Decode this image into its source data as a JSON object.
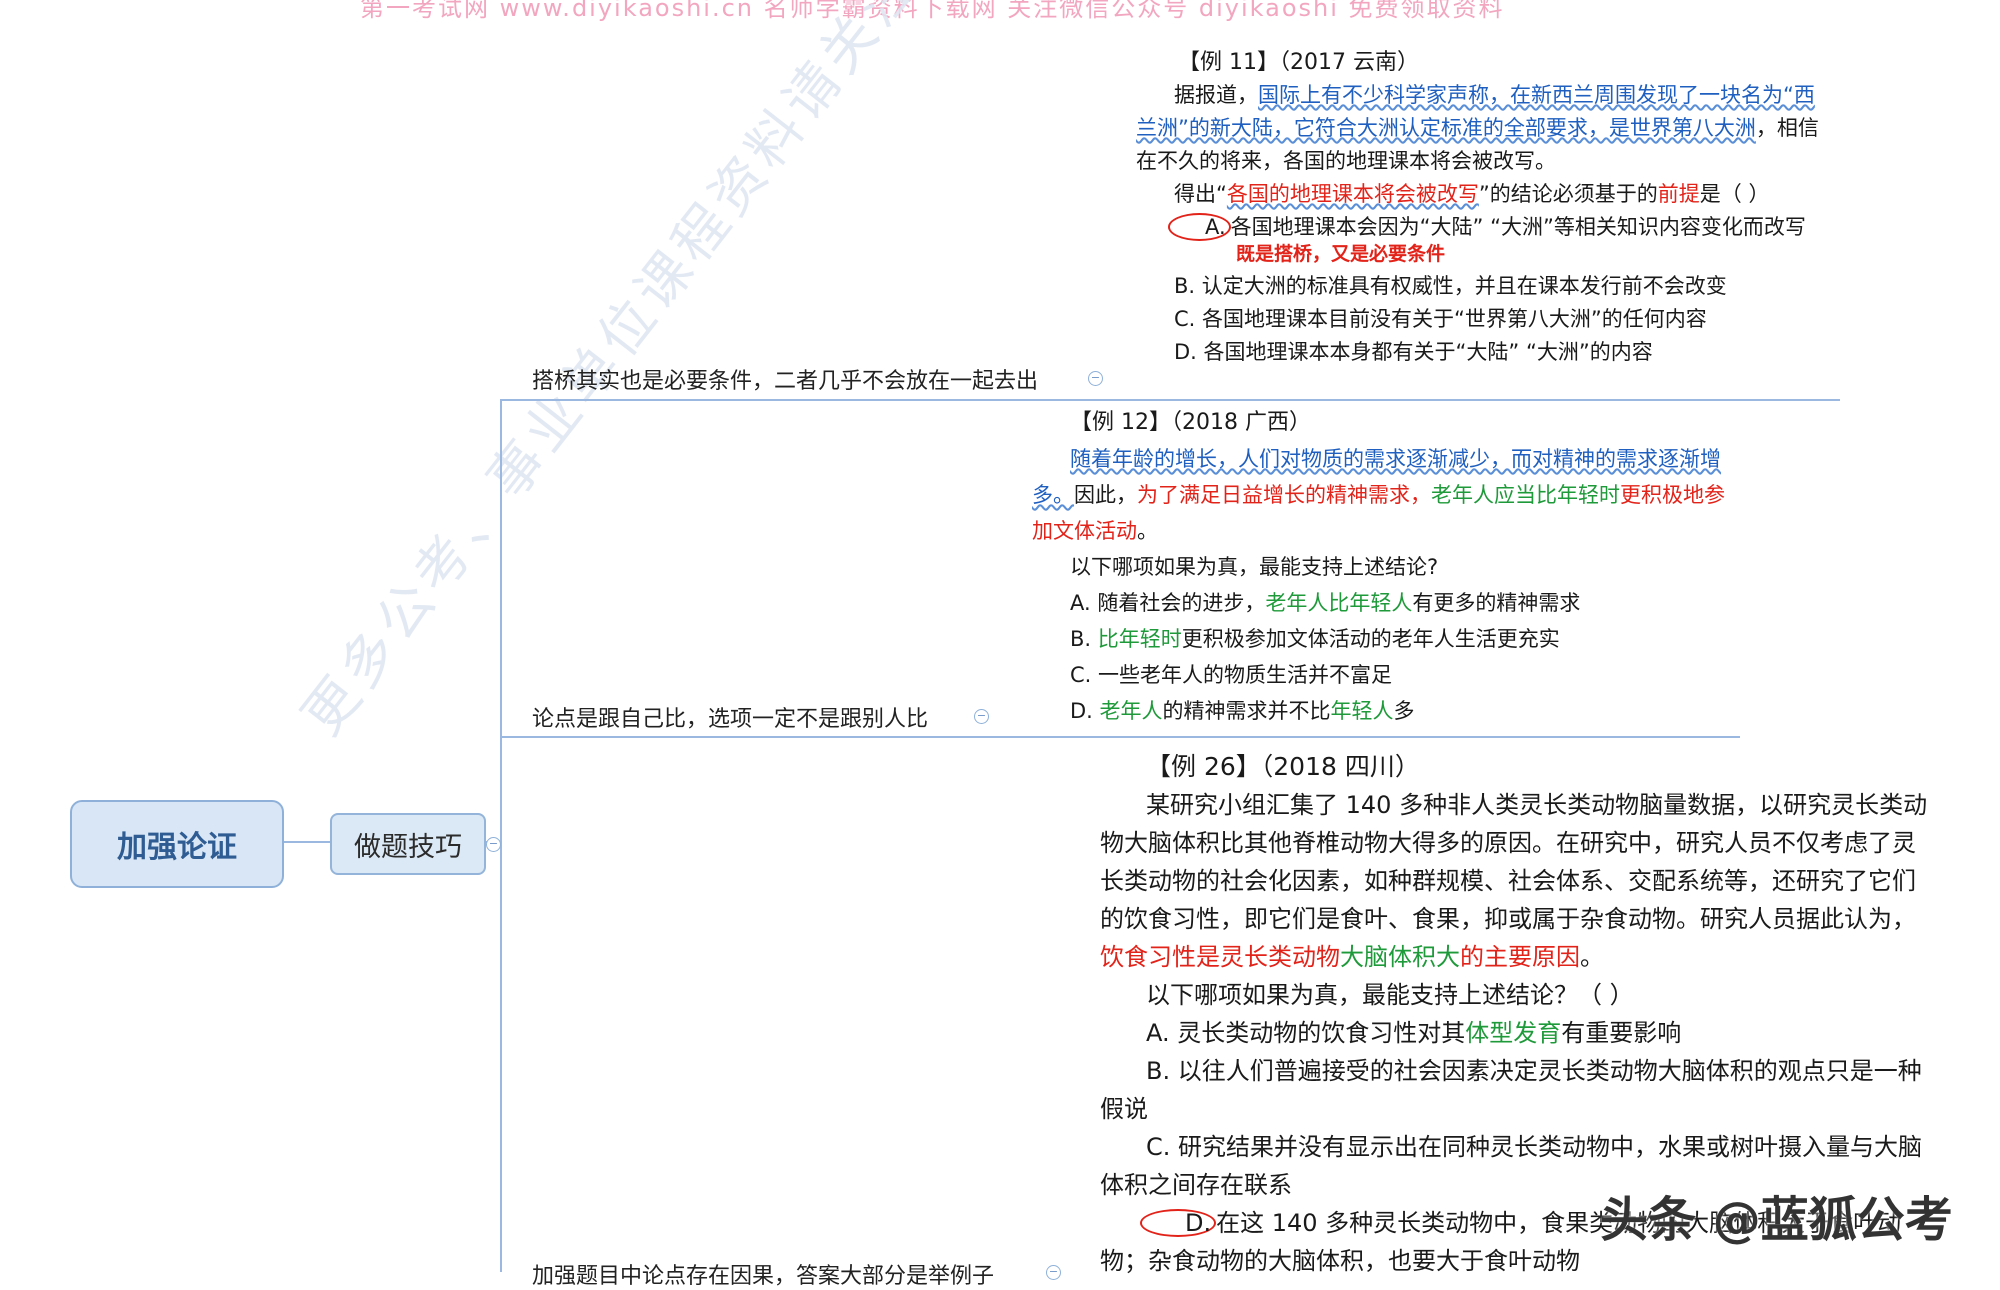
{
  "banner": "第一考试网 www.diyikaoshi.cn 名师学霸资料下载网 关注微信公众号 diyikaoshi 免费领取资料",
  "watermark": "更多公考、事业单位课程资料请关注",
  "brand": "头条 @蓝狐公考",
  "root": {
    "label": "加强论证"
  },
  "child": {
    "label": "做题技巧"
  },
  "branches": [
    {
      "label": "搭桥其实也是必要条件，二者几乎不会放在一起去出"
    },
    {
      "label": "论点是跟自己比，选项一定不是跟别人比"
    },
    {
      "label": "加强题目中论点存在因果，答案大部分是举例子"
    }
  ],
  "ex11": {
    "header": "【例 11】（2017 云南）",
    "p1_lead": "据报道，",
    "p1_blue": "国际上有不少科学家声称，在新西兰周围发现了一块名为“西兰洲”的新大陆，它符合大洲认定标准的全部要求，是世界第八大洲",
    "p1_tail": "，相信在不久的将来，各国的地理课本将会被改写。",
    "q_a": "得出“",
    "q_red": "各国的地理课本将会被改写",
    "q_b": "”的结论必须基于的",
    "q_red2": "前提",
    "q_c": "是（ ）",
    "optA_letter": "A.",
    "optA_text": "各国地理课本会因为“大陆” “大洲”等相关知识内容变化而改写",
    "note": "既是搭桥，又是必要条件",
    "optB": "B. 认定大洲的标准具有权威性，并且在课本发行前不会改变",
    "optC": "C. 各国地理课本目前没有关于“世界第八大洲”的任何内容",
    "optD": "D. 各国地理课本本身都有关于“大陆” “大洲”的内容"
  },
  "ex12": {
    "header": "【例 12】（2018 广西）",
    "blue": "随着年龄的增长，人们对物质的需求逐渐减少，而对精神的需求逐渐增多。",
    "mid": "因此，",
    "red1": "为了满足日益增长的精神需求，",
    "green1": "老年人应当比年轻时",
    "red2": "更积极地参加文体活动",
    "end": "。",
    "question": "以下哪项如果为真，最能支持上述结论?",
    "optA_a": "A. 随着社会的进步，",
    "optA_g": "老年人比年轻人",
    "optA_b": "有更多的精神需求",
    "optB_a": "B. ",
    "optB_g": "比年轻时",
    "optB_b": "更积极参加文体活动的老年人生活更充实",
    "optC": "C. 一些老年人的物质生活并不富足",
    "optD_a": "D. ",
    "optD_g": "老年人",
    "optD_b": "的精神需求并不比",
    "optD_g2": "年轻人",
    "optD_c": "多"
  },
  "ex26": {
    "header": "【例 26】（2018 四川）",
    "body": "某研究小组汇集了 140 多种非人类灵长类动物脑量数据，以研究灵长类动物大脑体积比其他脊椎动物大得多的原因。在研究中，研究人员不仅考虑了灵长类动物的社会化因素，如种群规模、社会体系、交配系统等，还研究了它们的饮食习性，即它们是食叶、食果，抑或属于杂食动物。研究人员据此认为，",
    "red1": "饮食习性是灵长类动物",
    "green1": "大脑体积大",
    "red2": "的主要原因",
    "end": "。",
    "question": "以下哪项如果为真，最能支持上述结论？（ ）",
    "optA_a": "A. 灵长类动物的饮食习性对其",
    "optA_g": "体型发育",
    "optA_b": "有重要影响",
    "optB": "B. 以往人们普遍接受的社会因素决定灵长类动物大脑体积的观点只是一种假说",
    "optC": "C. 研究结果并没有显示出在同种灵长类动物中，水果或树叶摄入量与大脑体积之间存在联系",
    "optD_letter": "D.",
    "optD_text": "在这 140 多种灵长类动物中，食果类动物的大脑体积大于食叶动物；杂食动物的大脑体积，也要大于食叶动物"
  }
}
